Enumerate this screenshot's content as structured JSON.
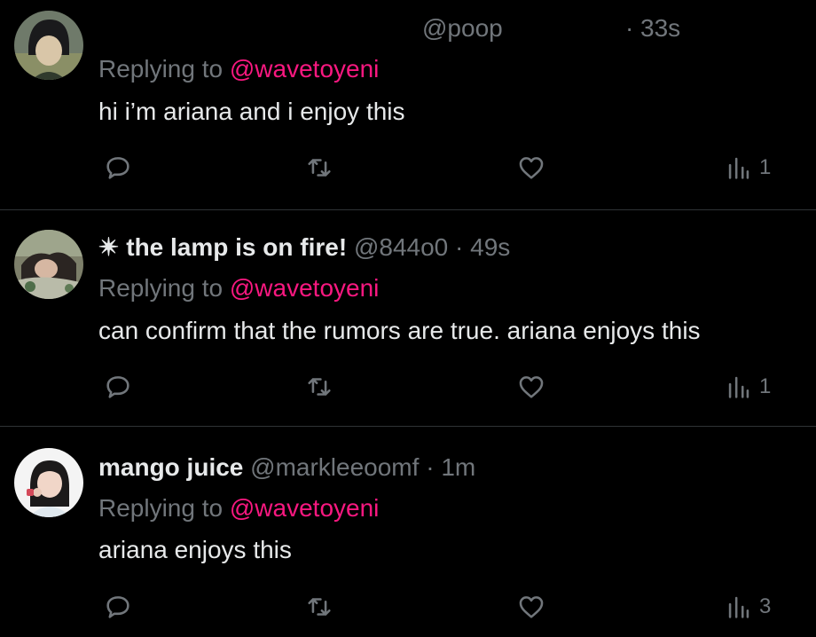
{
  "replies": [
    {
      "name": "",
      "handle": "@poop",
      "dot": "·",
      "time": "33s",
      "replying_prefix": "Replying to",
      "replying_to": "@wavetoyeni",
      "text": "hi i’m ariana and i enjoy this",
      "views": "1",
      "avatar_icon": "avatar-dark-hair-icon"
    },
    {
      "name": "✴ the lamp is on fire!",
      "handle": "@844o0",
      "dot": "·",
      "time": "49s",
      "replying_prefix": "Replying to",
      "replying_to": "@wavetoyeni",
      "text": "can confirm that the rumors are true. ariana enjoys this",
      "views": "1",
      "avatar_icon": "avatar-photo-icon"
    },
    {
      "name": "mango juice",
      "handle": "@markleeoomf",
      "dot": "·",
      "time": "1m",
      "replying_prefix": "Replying to",
      "replying_to": "@wavetoyeni",
      "text": "ariana enjoys this",
      "views": "3",
      "avatar_icon": "avatar-photo-icon"
    }
  ],
  "colors": {
    "background": "#000000",
    "text": "#e7e9ea",
    "muted": "#71767b",
    "mention": "#f91880",
    "divider": "#2f3336"
  }
}
